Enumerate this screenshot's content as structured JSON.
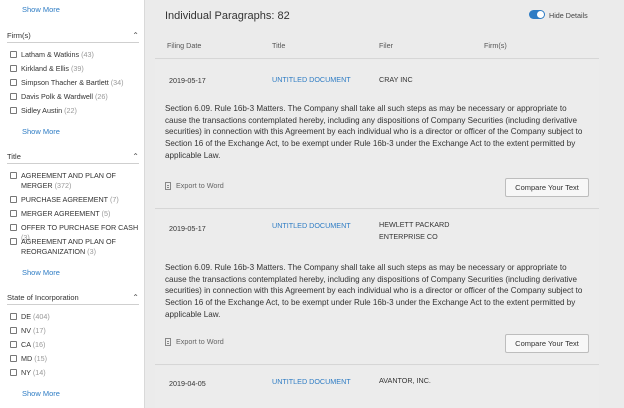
{
  "sidebar": {
    "show_more_label": "Show More",
    "firms": {
      "heading": "Firm(s)",
      "items": [
        {
          "label": "Latham & Watkins",
          "count": "(43)"
        },
        {
          "label": "Kirkland & Ellis",
          "count": "(39)"
        },
        {
          "label": "Simpson Thacher & Bartlett",
          "count": "(34)"
        },
        {
          "label": "Davis Polk & Wardwell",
          "count": "(26)"
        },
        {
          "label": "Sidley Austin",
          "count": "(22)"
        }
      ]
    },
    "title": {
      "heading": "Title",
      "items": [
        {
          "label": "AGREEMENT AND PLAN OF MERGER",
          "count": "(372)"
        },
        {
          "label": "PURCHASE AGREEMENT",
          "count": "(7)"
        },
        {
          "label": "MERGER AGREEMENT",
          "count": "(5)"
        },
        {
          "label": "OFFER TO PURCHASE FOR CASH",
          "count": "(3)"
        },
        {
          "label": "AGREEMENT AND PLAN OF REORGANIZATION",
          "count": "(3)"
        }
      ]
    },
    "state": {
      "heading": "State of Incorporation",
      "items": [
        {
          "label": "DE",
          "count": "(404)"
        },
        {
          "label": "NV",
          "count": "(17)"
        },
        {
          "label": "CA",
          "count": "(16)"
        },
        {
          "label": "MD",
          "count": "(15)"
        },
        {
          "label": "NY",
          "count": "(14)"
        }
      ]
    }
  },
  "main": {
    "heading": "Individual Paragraphs: 82",
    "toggle_label": "Hide Details",
    "columns": [
      "Filing Date",
      "Title",
      "Filer",
      "Firm(s)"
    ],
    "export_label": "Export to Word",
    "compare_label": "Compare Your Text",
    "results": [
      {
        "date": "2019-05-17",
        "title": "UNTITLED DOCUMENT",
        "filer": "CRAY INC",
        "paragraph": "Section 6.09. Rule 16b-3 Matters. The Company shall take all such steps as may be necessary or appropriate to cause the transactions contemplated hereby, including any dispositions of Company Securities (including derivative securities) in connection with this Agreement by each individual who is a director or officer of the Company subject to Section 16 of the Exchange Act, to be exempt under Rule 16b-3 under the Exchange Act to the extent permitted by applicable Law."
      },
      {
        "date": "2019-05-17",
        "title": "UNTITLED DOCUMENT",
        "filer": "HEWLETT PACKARD ENTERPRISE CO",
        "paragraph": "Section 6.09. Rule 16b-3 Matters. The Company shall take all such steps as may be necessary or appropriate to cause the transactions contemplated hereby, including any dispositions of Company Securities (including derivative securities) in connection with this Agreement by each individual who is a director or officer of the Company subject to Section 16 of the Exchange Act, to be exempt under Rule 16b-3 under the Exchange Act to the extent permitted by applicable Law."
      },
      {
        "date": "2019-04-05",
        "title": "UNTITLED DOCUMENT",
        "filer": "AVANTOR, INC."
      }
    ]
  }
}
